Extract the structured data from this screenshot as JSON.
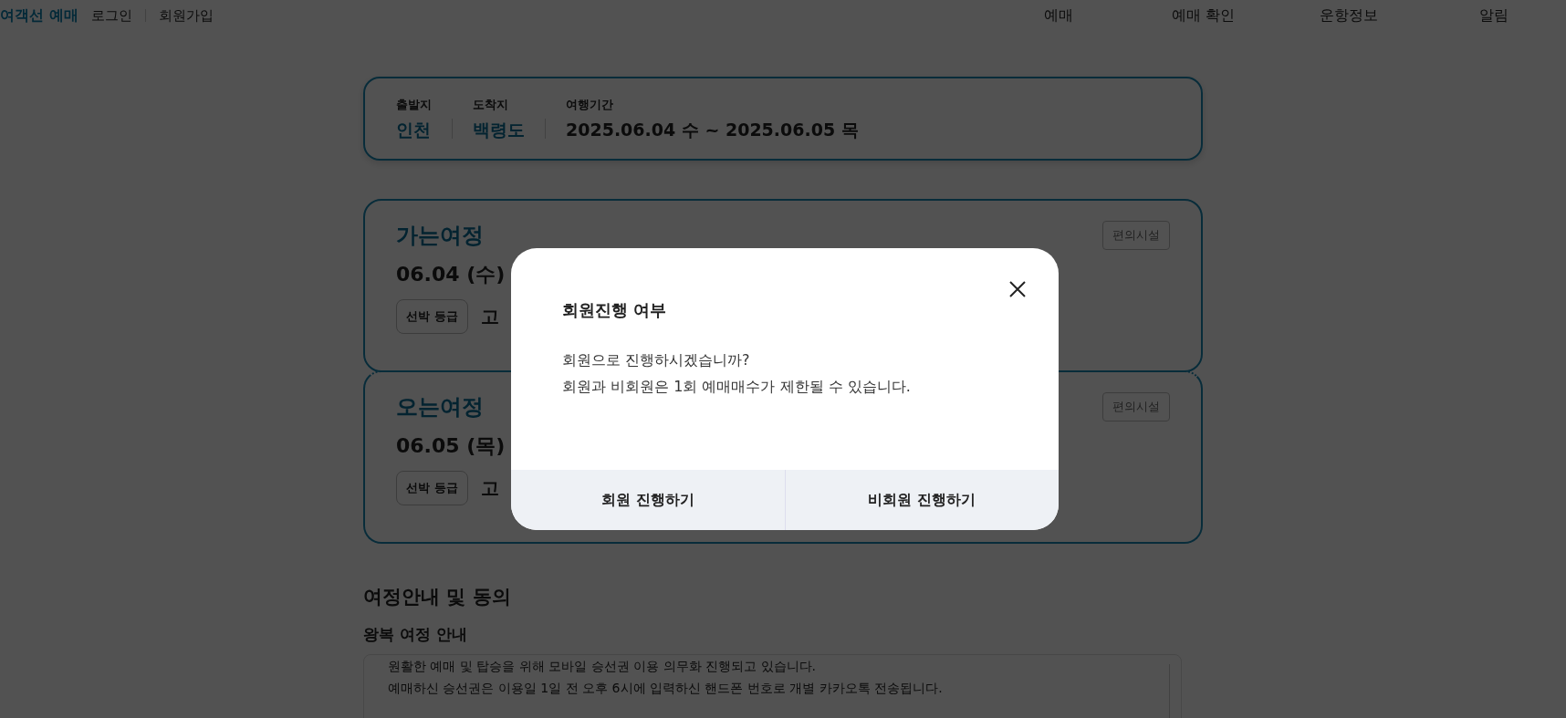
{
  "header": {
    "logo": "여객선 예매",
    "auth_links": [
      "로그인",
      "회원가입"
    ],
    "nav": [
      "예매",
      "예매 확인",
      "운항정보",
      "알림"
    ]
  },
  "search_summary": {
    "fields": [
      {
        "label": "출발지",
        "value": "인천",
        "kind": "place"
      },
      {
        "label": "도착지",
        "value": "백령도",
        "kind": "place"
      },
      {
        "label": "여행기간",
        "value": "2025.06.04 수 ~ 2025.06.05 목",
        "kind": "period"
      }
    ]
  },
  "journeys": [
    {
      "title": "가는여정",
      "date": "06.04 (수)",
      "facilities_button": "편의시설",
      "grade_label": "선박 등급",
      "grade_value": "고"
    },
    {
      "title": "오는여정",
      "date": "06.05 (목)",
      "facilities_button": "편의시설",
      "grade_label": "선박 등급",
      "grade_value": "고"
    }
  ],
  "guide": {
    "title": "여정안내 및 동의",
    "subtitle": "왕복 여정 안내",
    "lines": [
      "원활한 예매 및 탑승을 위해 모바일 승선권 이용 의무화 진행되고 있습니다.",
      "예매하신 승선권은 이용일 1일 전 오후 6시에 입력하신 핸드폰 번호로 개별 카카오톡 전송됩니다."
    ]
  },
  "modal": {
    "title": "회원진행 여부",
    "lines": [
      "회원으로 진행하시겠습니까?",
      "회원과 비회원은 1회 예매매수가 제한될 수 있습니다."
    ],
    "buttons": [
      "회원 진행하기",
      "비회원 진행하기"
    ]
  }
}
